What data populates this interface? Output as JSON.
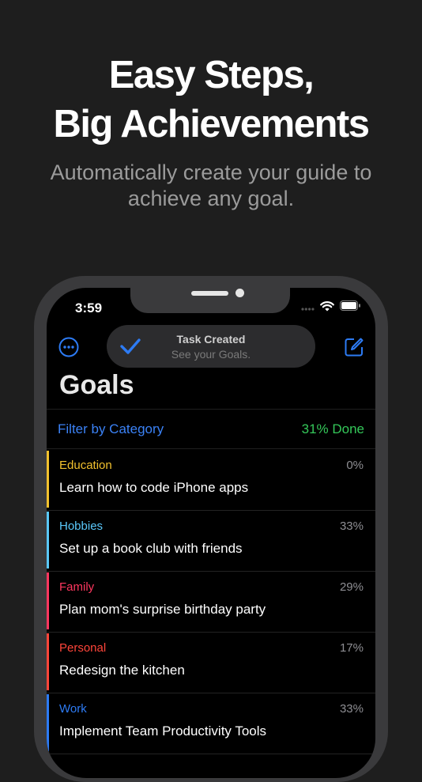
{
  "headline": {
    "line1": "Easy Steps,",
    "line2": "Big Achievements"
  },
  "subline": {
    "line1": "Automatically create your guide to",
    "line2": "achieve any goal."
  },
  "status_bar": {
    "time": "3:59",
    "icons": [
      "signal-icon",
      "wifi-icon",
      "battery-icon"
    ]
  },
  "toast": {
    "title": "Task Created",
    "subtitle": "See your Goals.",
    "icon": "checkmark-icon"
  },
  "nav": {
    "left_icon": "more-icon",
    "right_icon": "compose-icon",
    "title": "Goals"
  },
  "filter": {
    "label": "Filter by Category",
    "done": "31% Done"
  },
  "colors": {
    "accent": "#3b82f6",
    "done": "#34c759"
  },
  "goals": [
    {
      "category": "Education",
      "percent": "0%",
      "task": "Learn how to code iPhone apps",
      "color": "#f2c12e"
    },
    {
      "category": "Hobbies",
      "percent": "33%",
      "task": "Set up a book club with friends",
      "color": "#5ac8fa"
    },
    {
      "category": "Family",
      "percent": "29%",
      "task": "Plan mom's surprise birthday party",
      "color": "#ff375f"
    },
    {
      "category": "Personal",
      "percent": "17%",
      "task": "Redesign the kitchen",
      "color": "#ff453a"
    },
    {
      "category": "Work",
      "percent": "33%",
      "task": "Implement Team Productivity Tools",
      "color": "#2d7bf4"
    }
  ]
}
